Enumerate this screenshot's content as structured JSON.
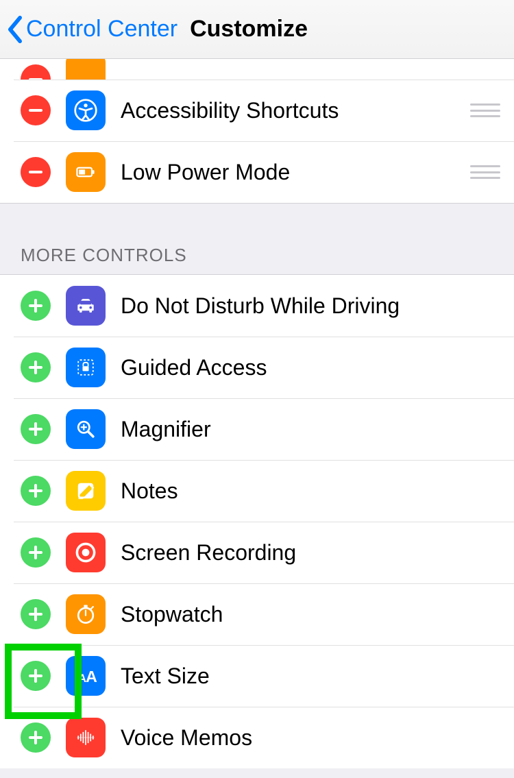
{
  "nav": {
    "back_label": "Control Center",
    "title": "Customize"
  },
  "section_header": "MORE CONTROLS",
  "included": [
    {
      "label": "",
      "icon": "partial-orange"
    },
    {
      "label": "Accessibility Shortcuts",
      "icon": "accessibility"
    },
    {
      "label": "Low Power Mode",
      "icon": "low-power"
    }
  ],
  "more": [
    {
      "label": "Do Not Disturb While Driving",
      "icon": "car"
    },
    {
      "label": "Guided Access",
      "icon": "guided-access"
    },
    {
      "label": "Magnifier",
      "icon": "magnifier"
    },
    {
      "label": "Notes",
      "icon": "notes"
    },
    {
      "label": "Screen Recording",
      "icon": "record"
    },
    {
      "label": "Stopwatch",
      "icon": "stopwatch"
    },
    {
      "label": "Text Size",
      "icon": "text-size"
    },
    {
      "label": "Voice Memos",
      "icon": "voice-memos"
    }
  ]
}
